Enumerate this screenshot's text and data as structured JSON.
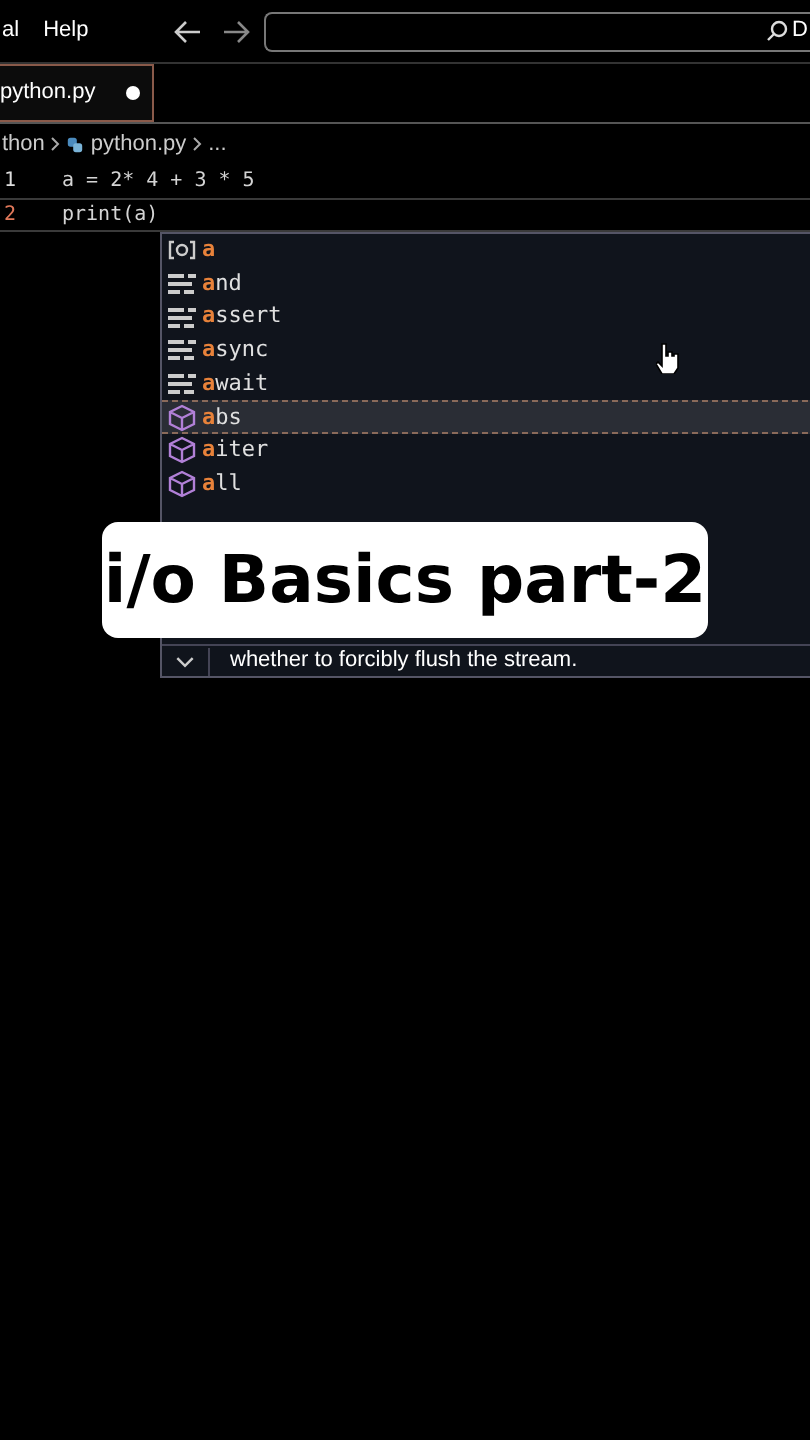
{
  "menu": [
    "al",
    "Help"
  ],
  "search": {
    "value": "D"
  },
  "tab": {
    "label": "python.py",
    "modified": true
  },
  "breadcrumb": [
    "thon",
    "python.py",
    "..."
  ],
  "code": [
    {
      "number": "1",
      "text": "a = 2* 4 + 3 * 5",
      "current": false
    },
    {
      "number": "2",
      "text": "print(a)",
      "current": true
    }
  ],
  "suggestions": [
    {
      "kind": "variable",
      "match": "a",
      "selected": false
    },
    {
      "kind": "keyword",
      "match": "a",
      "rest": "nd",
      "selected": false
    },
    {
      "kind": "keyword",
      "match": "a",
      "rest": "ssert",
      "selected": false
    },
    {
      "kind": "keyword",
      "match": "a",
      "rest": "sync",
      "selected": false
    },
    {
      "kind": "keyword",
      "match": "a",
      "rest": "wait",
      "selected": false
    },
    {
      "kind": "function",
      "match": "a",
      "rest": "bs",
      "selected": true
    },
    {
      "kind": "function",
      "match": "a",
      "rest": "iter",
      "selected": false
    },
    {
      "kind": "function",
      "match": "a",
      "rest": "ll",
      "selected": false
    }
  ],
  "details": "whether to forcibly flush the stream.",
  "caption": "i/o Basics part-2"
}
